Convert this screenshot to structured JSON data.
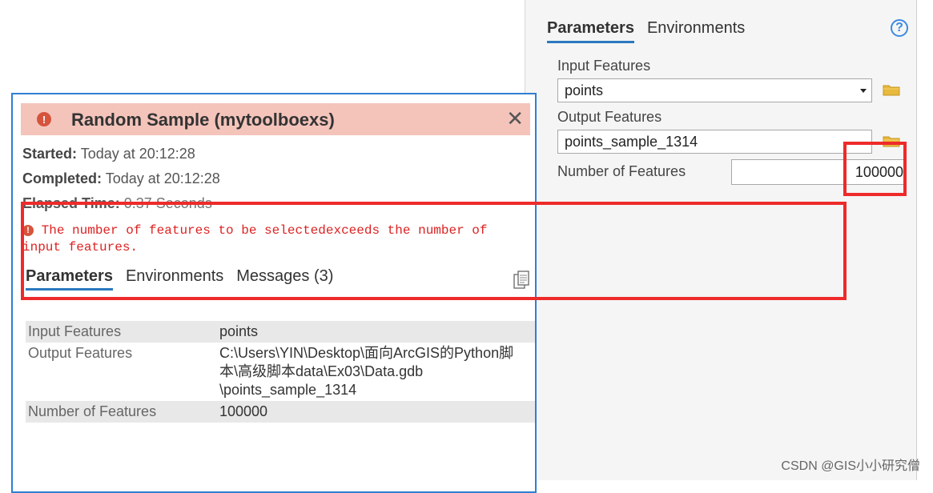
{
  "gp_pane": {
    "tabs": [
      {
        "label": "Parameters",
        "active": true
      },
      {
        "label": "Environments",
        "active": false
      }
    ],
    "help_label": "?",
    "input_features": {
      "label": "Input Features",
      "value": "points"
    },
    "output_features": {
      "label": "Output Features",
      "value": "points_sample_1314"
    },
    "number_of_features": {
      "label": "Number of Features",
      "value": "100000"
    }
  },
  "result_popup": {
    "title": "Random Sample (mytoolboexs)",
    "status": "error",
    "started": {
      "label": "Started:",
      "value": "Today at 20:12:28"
    },
    "completed": {
      "label": "Completed:",
      "value": "Today at 20:12:28"
    },
    "elapsed": {
      "label": "Elapsed Time:",
      "value": "0.37 Seconds"
    },
    "error_message": "The number of features to be selectedexceeds the number of input features.",
    "tabs": [
      {
        "label": "Parameters",
        "active": true
      },
      {
        "label": "Environments",
        "active": false
      },
      {
        "label": "Messages (3)",
        "active": false
      }
    ],
    "params": [
      {
        "name": "Input Features",
        "value": "points"
      },
      {
        "name": "Output Features",
        "value_lines": [
          "C:\\Users\\YIN\\Desktop\\面向ArcGIS的Python脚",
          "本\\高级脚本data\\Ex03\\Data.gdb",
          "\\points_sample_1314"
        ]
      },
      {
        "name": "Number of Features",
        "value": "100000"
      }
    ]
  },
  "watermark": "CSDN @GIS小小研究僧",
  "colors": {
    "accent": "#2b79bf",
    "error": "#d6543c",
    "header_bg": "#f4c4bb",
    "highlight": "#ee2a2a"
  }
}
